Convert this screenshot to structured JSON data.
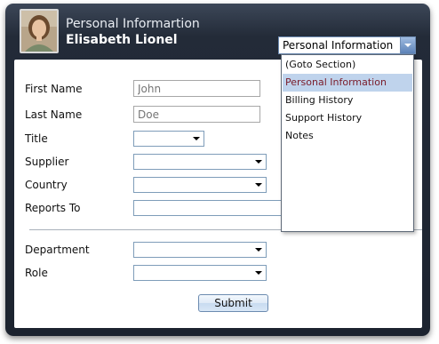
{
  "header": {
    "title": "Personal Informartion",
    "name": "Elisabeth Lionel",
    "photo_icon": "person-photo"
  },
  "form": {
    "first_name_label": "First Name",
    "first_name_placeholder": "John",
    "last_name_label": "Last Name",
    "last_name_placeholder": "Doe",
    "title_label": "Title",
    "supplier_label": "Supplier",
    "country_label": "Country",
    "reports_to_label": "Reports To",
    "department_label": "Department",
    "role_label": "Role",
    "submit_label": "Submit"
  },
  "section_combo": {
    "selected": "Personal Information",
    "options": [
      "(Goto Section)",
      "Personal Information",
      "Billing History",
      "Support History",
      "Notes"
    ]
  },
  "colors": {
    "header_bg": "#1c232f",
    "selected_option_bg": "#bfd3ec",
    "selected_option_text": "#7a1c2a",
    "combo_button": "#5d83b8"
  }
}
